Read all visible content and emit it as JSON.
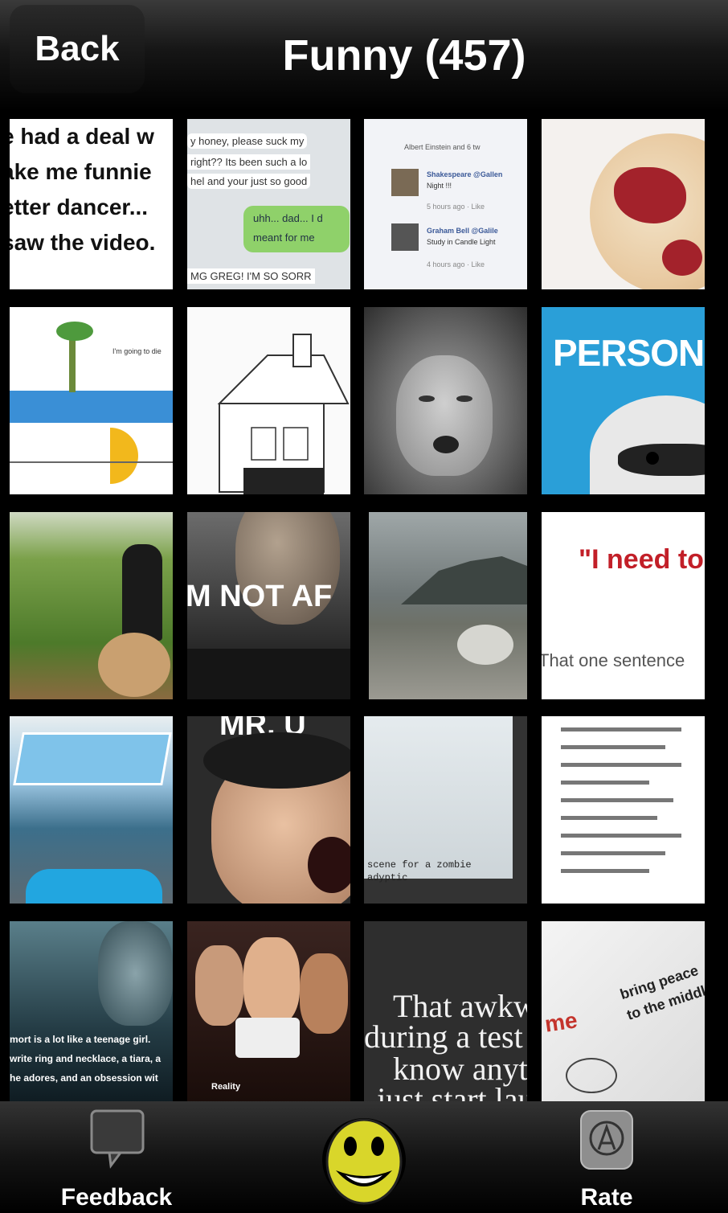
{
  "nav": {
    "back_label": "Back",
    "title": "Funny (457)"
  },
  "tiles": {
    "t1": {
      "lines": [
        "e had a deal w",
        "ake me funnie",
        "etter dancer...",
        "saw the video."
      ]
    },
    "t2": {
      "lines": [
        "y honey, please suck my",
        "right?? Its been such a lo",
        "hel and your just so good",
        "uhh... dad... I d",
        "meant for me",
        "MG GREG! I'M SO SORR"
      ]
    },
    "t3": {
      "lines": [
        "Albert Einstein and 6 tw",
        "Shakespeare @Gallen",
        "Night !!!",
        "5 hours ago · Like",
        "Graham Bell @Galile",
        "Study in Candle Light",
        "4 hours ago · Like"
      ]
    },
    "t6": {
      "lines": [
        "I'm going to die"
      ]
    },
    "t8": {
      "lines": [
        "PERSON M"
      ]
    },
    "t10": {
      "lines": [
        "M NOT AF"
      ]
    },
    "t12": {
      "lines": [
        "\"I need to",
        "That one sentence"
      ]
    },
    "t14": {
      "lines": [
        "MR. U"
      ]
    },
    "t15": {
      "lines": [
        "scene for a zombie",
        "adyptic"
      ]
    },
    "t17": {
      "lines": [
        "mort is a lot like a teenage girl.",
        "write ring and necklace, a tiara, a",
        "he adores, and an obsession wit"
      ]
    },
    "t18": {
      "lines": [
        "Reality"
      ]
    },
    "t19": {
      "lines": [
        "That awkw",
        "during a test",
        "know anyt",
        "just start lau"
      ]
    },
    "t20": {
      "lines": [
        "bring peace",
        "to the middle",
        "me"
      ]
    }
  },
  "tabbar": {
    "feedback_label": "Feedback",
    "rate_label": "Rate"
  },
  "colors": {
    "smiley": "#d9d62a",
    "background": "#000000",
    "text": "#ffffff"
  }
}
